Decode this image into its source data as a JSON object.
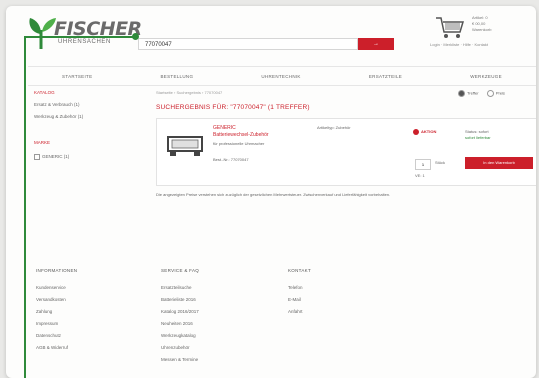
{
  "brand": {
    "name": "FISCHER",
    "tagline": "UHRENSACHEN"
  },
  "search": {
    "query": "77070047",
    "button_label": "→"
  },
  "cart": {
    "meta": [
      "Artikel: 0",
      "€ 00,00",
      "Warenkorb"
    ],
    "links": "Login · Merkliste · Hilfe · Kontakt"
  },
  "nav": {
    "items": [
      "STARTSEITE",
      "BESTELLUNG",
      "UHRENTECHNIK",
      "ERSATZTEILE",
      "WERKZEUGE"
    ]
  },
  "sidebar": {
    "filter_title": "KATALOG",
    "filters": [
      "Ersatz & Verbrauch (1)",
      "Werkzeug & Zubehör (1)"
    ],
    "brand_title": "MARKE",
    "brands": [
      "GENERIC (1)"
    ]
  },
  "breadcrumb": "Startseite › Suchergebnis › 77070047",
  "sort": {
    "option_a": "Treffer",
    "option_b": "Preis"
  },
  "results": {
    "heading": "SUCHERGEBNIS FÜR: \"77070047\" (1 TREFFER)",
    "product": {
      "title": "GENERIC",
      "subtitle": "Batteriewechsel-Zubehör",
      "description": "für professionelle Uhrmacher",
      "article_number": "Best.-Nr.: 77070047",
      "type_label": "Artikeltyp: Zubehör",
      "promo_label": "AKTION",
      "availability_label": "Status: sofort",
      "availability_status": "sofort lieferbar",
      "quantity": "1",
      "quantity_unit": "Stück",
      "pack_label": "VE: 1",
      "add_button_label": "In den Warenkorb"
    },
    "note": "Die angezeigten Preise verstehen sich zuzüglich der gesetzlichen Mehrwertsteuer. Zwischenverkauf und Lieferfähigkeit vorbehalten."
  },
  "footer": {
    "columns": [
      {
        "title": "INFORMATIONEN",
        "items": [
          "Kundenservice",
          "Versandkosten",
          "Zahlung",
          "Impressum",
          "Datenschutz",
          "AGB & Widerruf"
        ]
      },
      {
        "title": "SERVICE & FAQ",
        "items": [
          "Ersatzteilsuche",
          "Batterieliste 2016",
          "Katalog 2016/2017",
          "Neuheiten 2016",
          "Werkzeugkatalog",
          "Uhrenzubehör",
          "Messen & Termine"
        ]
      },
      {
        "title": "KONTAKT",
        "items": [
          "Telefon",
          "E-Mail",
          "Anfahrt"
        ]
      }
    ]
  },
  "colors": {
    "accent": "#cc1f2a",
    "brand_green": "#2f8a3a",
    "text": "#666666"
  },
  "icons": [
    "logo-leaf-icon",
    "cart-icon",
    "arrow-right-icon",
    "product-thumbnail",
    "promo-badge-icon"
  ]
}
